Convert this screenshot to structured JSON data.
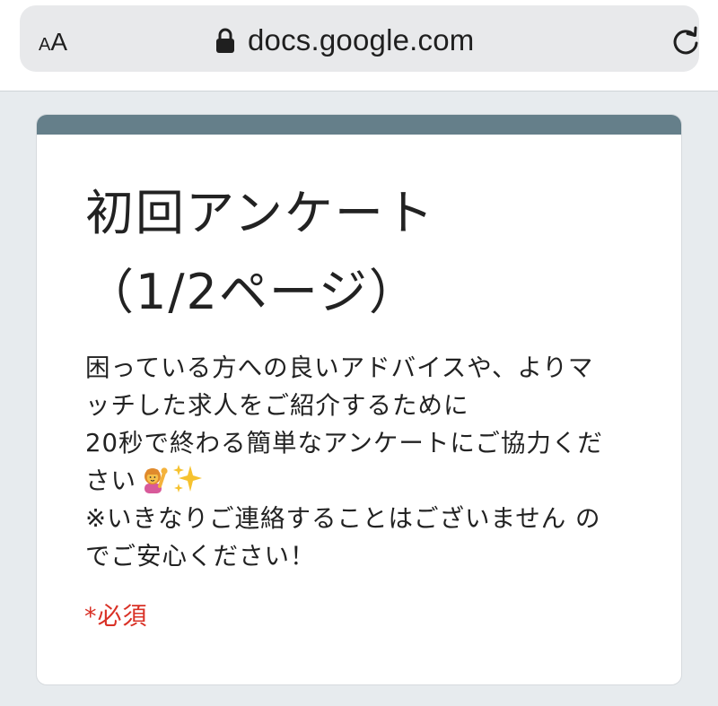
{
  "browser": {
    "text_size_button": {
      "small": "A",
      "large": "A"
    },
    "url": "docs.google.com",
    "icons": {
      "lock": "lock-icon",
      "reload": "reload-icon"
    }
  },
  "form": {
    "accent_color": "#657f8a",
    "title_lines": [
      "初回アンケート",
      "（1/2ページ）"
    ],
    "description_lines": [
      "困っている方への良いアドバイスや、よりマ",
      "ッチした求人をご紹介するために",
      "20秒で終わる簡単なアンケートにご協力くだ",
      "さい",
      "※いきなりご連絡することはございません の",
      "でご安心ください！"
    ],
    "description_emoji": [
      "raising-hand-icon",
      "sparkles-icon"
    ],
    "required_note": "*必須",
    "required_color": "#d93025"
  }
}
